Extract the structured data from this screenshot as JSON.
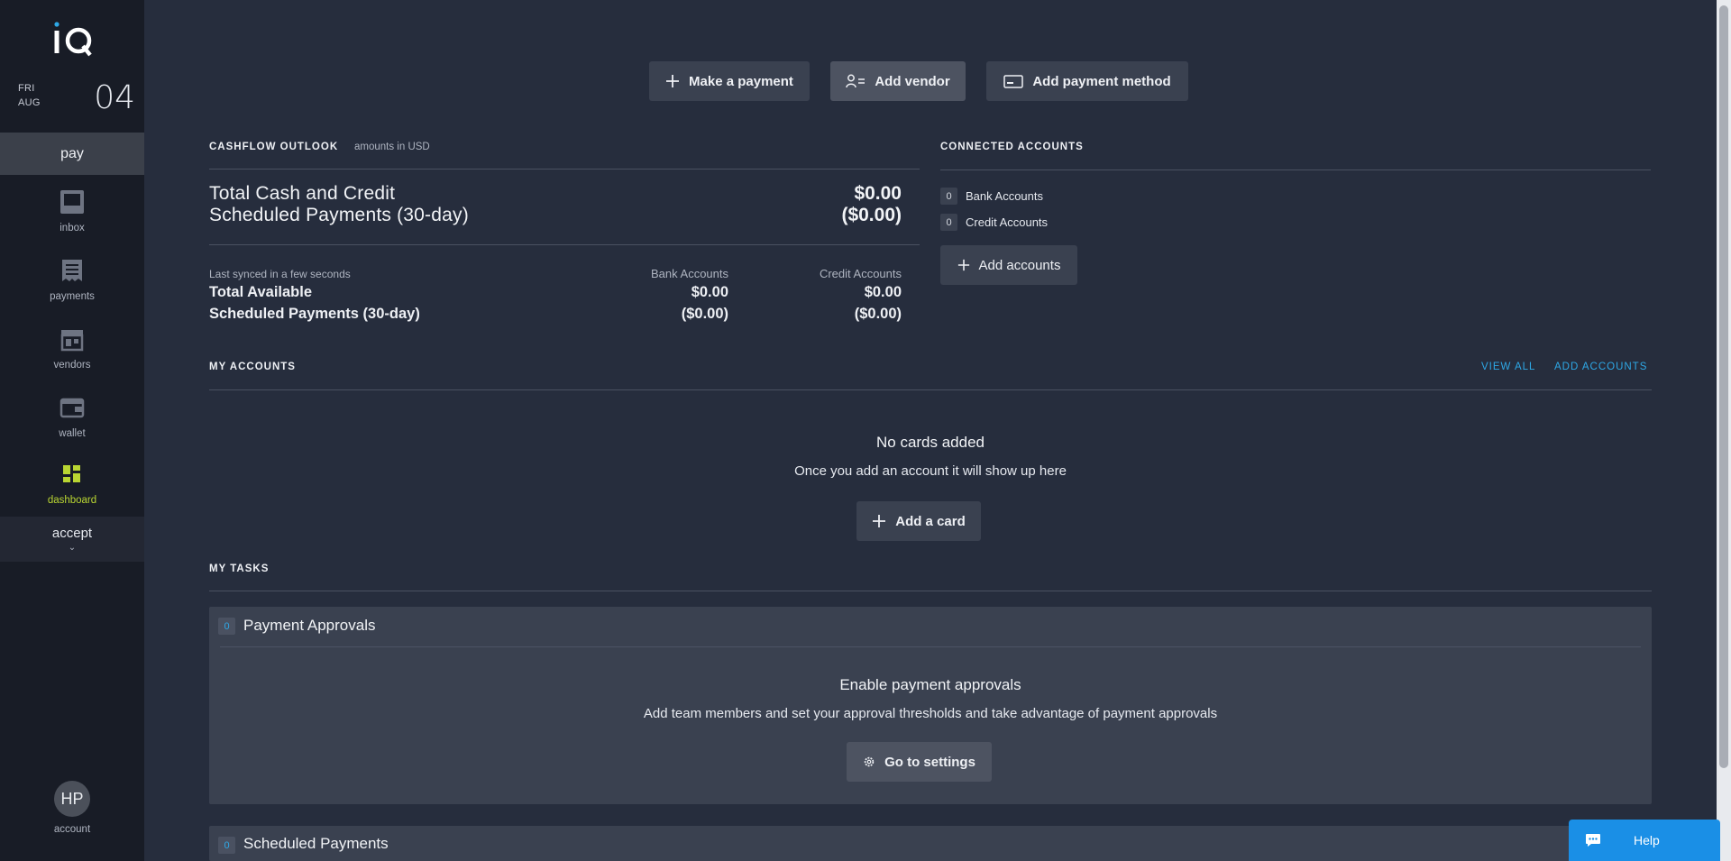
{
  "sidebar": {
    "logo_text": "iQ",
    "date": {
      "dow": "FRI",
      "month": "AUG",
      "day": "04"
    },
    "section_pay": "pay",
    "items": [
      {
        "label": "inbox",
        "icon": "inbox-icon"
      },
      {
        "label": "payments",
        "icon": "receipt-icon"
      },
      {
        "label": "vendors",
        "icon": "store-icon"
      },
      {
        "label": "wallet",
        "icon": "wallet-icon"
      },
      {
        "label": "dashboard",
        "icon": "dashboard-icon",
        "active": true
      }
    ],
    "section_accept": "accept",
    "section_accept_chevron": "⌄",
    "account": {
      "initials": "HP",
      "label": "account"
    },
    "active_color": "#b9d532"
  },
  "actions": {
    "make_payment": "Make a payment",
    "add_vendor": "Add vendor",
    "add_payment_method": "Add payment method"
  },
  "cashflow": {
    "heading": "CASHFLOW OUTLOOK",
    "note": "amounts in USD",
    "row1_label": "Total Cash and Credit",
    "row1_amount": "$0.00",
    "row2_label": "Scheduled Payments (30-day)",
    "row2_amount": "($0.00)",
    "synced": "Last synced in a few seconds",
    "col_bank": "Bank Accounts",
    "col_credit": "Credit Accounts",
    "total_available_label": "Total Available",
    "scheduled_label": "Scheduled Payments (30-day)",
    "bank_available": "$0.00",
    "credit_available": "$0.00",
    "bank_scheduled": "($0.00)",
    "credit_scheduled": "($0.00)"
  },
  "connected": {
    "heading": "CONNECTED ACCOUNTS",
    "bank_count": "0",
    "bank_label": "Bank Accounts",
    "credit_count": "0",
    "credit_label": "Credit Accounts",
    "add_button": "Add accounts"
  },
  "my_accounts": {
    "heading": "MY ACCOUNTS",
    "view_all": "VIEW ALL",
    "add_accounts": "ADD ACCOUNTS",
    "empty_title": "No cards added",
    "empty_sub": "Once you add an account it will show up here",
    "add_card": "Add a card"
  },
  "my_tasks": {
    "heading": "MY TASKS",
    "approvals": {
      "count": "0",
      "title": "Payment Approvals",
      "empty_title": "Enable payment approvals",
      "empty_sub": "Add team members and set your approval thresholds and take advantage of payment approvals",
      "button": "Go to settings"
    },
    "scheduled": {
      "count": "0",
      "title": "Scheduled Payments"
    }
  },
  "help": {
    "label": "Help"
  },
  "colors": {
    "accent_blue": "#2ea8e6",
    "help_blue": "#1a8fe6",
    "bg": "#262d3d",
    "sidebar_bg": "#181c26"
  }
}
